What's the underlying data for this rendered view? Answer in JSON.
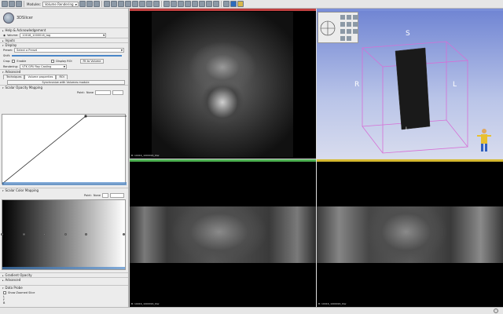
{
  "toolbar": {
    "modules_label": "Modules:",
    "module_combo": "Volume Rendering"
  },
  "panel": {
    "logo_text": "3DSlicer",
    "sections": {
      "help": "Help & Acknowledgement",
      "inputs": "Inputs",
      "display": "Display",
      "advanced": "Advanced",
      "scalar_opacity": "Scalar Opacity Mapping",
      "scalar_color": "Scalar Color Mapping",
      "gradient_opacity": "Gradient Opacity",
      "advanced2": "Advanced",
      "data_probe": "Data Probe"
    },
    "volume_label": "Volume:",
    "volume_value": "10016_1000016_tag",
    "preset_label": "Preset:",
    "preset_value": "Select a Preset",
    "shift_label": "Shift:",
    "crop_label": "Crop:",
    "crop_enable": "Enable",
    "display_roi": "Display ROI",
    "fit_button": "Fit to Volume",
    "rendering_label": "Rendering:",
    "rendering_value": "VTK GPU Ray Casting",
    "tabs": [
      "Techniques",
      "Volume properties",
      "ROI"
    ],
    "sync_button": "Synchronize with Volumes module",
    "point_label": "Point:",
    "point_value": "None",
    "color_point_label": "Point:",
    "color_point_value": "None",
    "show_zoomed": "Show Zoomed Slice",
    "probe_lines": [
      "L",
      "F",
      "B"
    ]
  },
  "views": {
    "red_label": "B: 10016_1000016_t2w",
    "green_label": "B: 10016_1000016_t2w",
    "yellow_label": "B: 10016_1000016_t2w",
    "axis_s": "S",
    "axis_r": "R",
    "axis_l": "L",
    "axis_i": "I"
  },
  "colors": {
    "red_view": "#c04040",
    "green_view": "#4caf50",
    "yellow_view": "#d4b830",
    "box": "#d66fd6"
  }
}
